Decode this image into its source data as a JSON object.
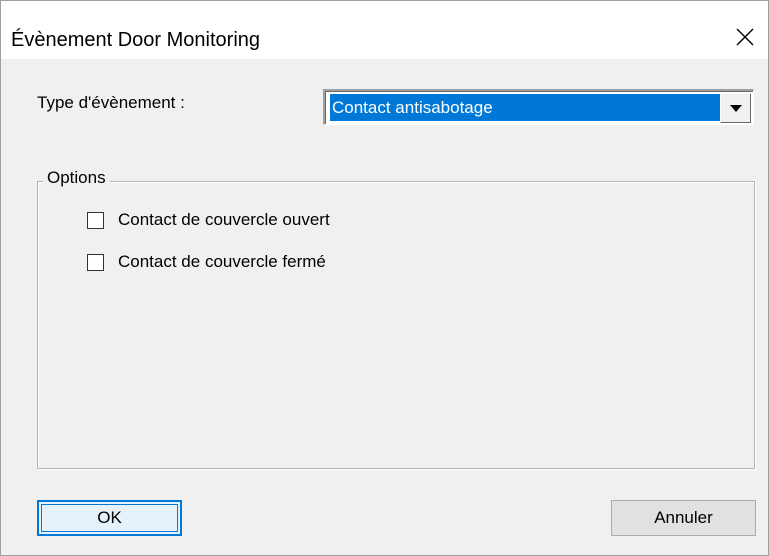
{
  "window": {
    "title": "Évènement Door Monitoring"
  },
  "form": {
    "type_label": "Type d'évènement :",
    "type_select": {
      "selected": "Contact antisabotage"
    }
  },
  "options": {
    "group_label": "Options",
    "checkboxes": [
      {
        "label": "Contact de couvercle ouvert",
        "checked": false
      },
      {
        "label": "Contact de couvercle fermé",
        "checked": false
      }
    ]
  },
  "buttons": {
    "ok": "OK",
    "cancel": "Annuler"
  },
  "icons": {
    "close": "close-icon",
    "dropdown": "chevron-down-icon"
  },
  "colors": {
    "accent": "#0078d7",
    "dialog_bg": "#f0f0f0",
    "titlebar_bg": "#ffffff"
  }
}
